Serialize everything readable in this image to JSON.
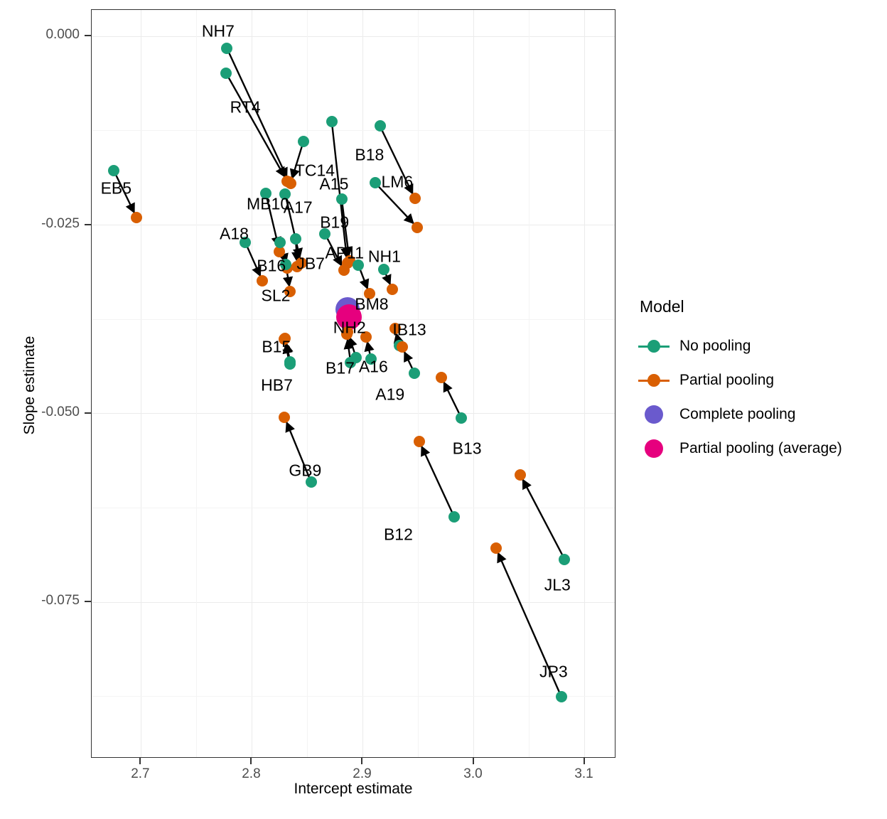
{
  "chart_data": {
    "type": "scatter",
    "title": "",
    "xlabel": "Intercept estimate",
    "ylabel": "Slope estimate",
    "xlim": [
      2.6555,
      3.1285
    ],
    "ylim": [
      -0.0957,
      0.0035
    ],
    "xticks": [
      2.7,
      2.8,
      2.9,
      3.0,
      3.1
    ],
    "xtick_labels": [
      "2.7",
      "2.8",
      "2.9",
      "3.0",
      "3.1"
    ],
    "yticks": [
      0.0,
      -0.025,
      -0.05,
      -0.075
    ],
    "ytick_labels": [
      "0.000",
      "-0.025",
      "-0.050",
      "-0.075"
    ],
    "grid": true,
    "legend_position": "right",
    "legend_title": "Model",
    "series": [
      {
        "name": "No pooling",
        "color": "#1b9e77",
        "marker": "circle"
      },
      {
        "name": "Partial pooling",
        "color": "#d95f02",
        "marker": "circle"
      },
      {
        "name": "Complete pooling",
        "color": "#6a5acd",
        "marker": "circle"
      },
      {
        "name": "Partial pooling (average)",
        "color": "#e6007e",
        "marker": "circle"
      }
    ],
    "complete_pooling": {
      "x": 2.8865,
      "y": -0.0362,
      "label": "Complete pooling"
    },
    "partial_pooling_average": {
      "x": 2.8877,
      "y": -0.0372,
      "label": "Partial pooling (average)"
    },
    "points": [
      {
        "label": "NH7",
        "no_pooling": {
          "x": 2.7775,
          "y": -0.0016
        },
        "partial_pooling": {
          "x": 2.8335,
          "y": -0.0193
        },
        "label_x": 2.7695,
        "label_y": 0.0007
      },
      {
        "label": "RT4",
        "no_pooling": {
          "x": 2.7768,
          "y": -0.0049
        },
        "partial_pooling": {
          "x": 2.8318,
          "y": -0.0192
        },
        "label_x": 2.794,
        "label_y": -0.0094
      },
      {
        "label": "TC14",
        "no_pooling": {
          "x": 2.8465,
          "y": -0.0139
        },
        "partial_pooling": {
          "x": 2.8348,
          "y": -0.0195
        },
        "label_x": 2.8567,
        "label_y": -0.0178
      },
      {
        "label": "EB5",
        "no_pooling": {
          "x": 2.6755,
          "y": -0.0178
        },
        "partial_pooling": {
          "x": 2.696,
          "y": -0.024
        },
        "label_x": 2.6775,
        "label_y": -0.0201
      },
      {
        "label": "B18",
        "no_pooling": {
          "x": 2.9155,
          "y": -0.0119
        },
        "partial_pooling": {
          "x": 2.947,
          "y": -0.0215
        },
        "label_x": 2.906,
        "label_y": -0.0157
      },
      {
        "label": "LM6",
        "no_pooling": {
          "x": 2.911,
          "y": -0.0194
        },
        "partial_pooling": {
          "x": 2.949,
          "y": -0.0253
        },
        "label_x": 2.931,
        "label_y": -0.0193
      },
      {
        "label": "A15",
        "no_pooling": {
          "x": 2.872,
          "y": -0.0113
        },
        "partial_pooling": {
          "x": 2.886,
          "y": -0.03
        },
        "label_x": 2.874,
        "label_y": -0.0196
      },
      {
        "label": "MB10",
        "no_pooling": {
          "x": 2.8125,
          "y": -0.0208
        },
        "partial_pooling": {
          "x": 2.825,
          "y": -0.0285
        },
        "label_x": 2.8145,
        "label_y": -0.0222
      },
      {
        "label": "A17",
        "no_pooling": {
          "x": 2.83,
          "y": -0.0209
        },
        "partial_pooling": {
          "x": 2.8443,
          "y": -0.03
        },
        "label_x": 2.8415,
        "label_y": -0.0227
      },
      {
        "label": "B19",
        "no_pooling": {
          "x": 2.881,
          "y": -0.0216
        },
        "partial_pooling": {
          "x": 2.888,
          "y": -0.0298
        },
        "label_x": 2.8745,
        "label_y": -0.0247
      },
      {
        "label": "A18",
        "no_pooling": {
          "x": 2.794,
          "y": -0.0273
        },
        "partial_pooling": {
          "x": 2.8095,
          "y": -0.0324
        },
        "label_x": 2.784,
        "label_y": -0.0262
      },
      {
        "label": "B16",
        "no_pooling": {
          "x": 2.8255,
          "y": -0.0273
        },
        "partial_pooling": {
          "x": 2.832,
          "y": -0.0307
        },
        "label_x": 2.8175,
        "label_y": -0.0304
      },
      {
        "label": "JB7",
        "no_pooling": {
          "x": 2.8395,
          "y": -0.0268
        },
        "partial_pooling": {
          "x": 2.841,
          "y": -0.0305
        },
        "label_x": 2.853,
        "label_y": -0.0301
      },
      {
        "label": "AP11",
        "no_pooling": {
          "x": 2.866,
          "y": -0.0262
        },
        "partial_pooling": {
          "x": 2.883,
          "y": -0.031
        },
        "label_x": 2.8835,
        "label_y": -0.0287
      },
      {
        "label": "SL2",
        "no_pooling": {
          "x": 2.8305,
          "y": -0.0302
        },
        "partial_pooling": {
          "x": 2.8345,
          "y": -0.0338
        },
        "label_x": 2.8215,
        "label_y": -0.0344
      },
      {
        "label": "NH1",
        "no_pooling": {
          "x": 2.919,
          "y": -0.0309
        },
        "partial_pooling": {
          "x": 2.9265,
          "y": -0.0335
        },
        "label_x": 2.9195,
        "label_y": -0.0292
      },
      {
        "label": "BM8",
        "no_pooling": {
          "x": 2.896,
          "y": -0.0303
        },
        "partial_pooling": {
          "x": 2.906,
          "y": -0.0341
        },
        "label_x": 2.908,
        "label_y": -0.0355
      },
      {
        "label": "NH2",
        "no_pooling": {
          "x": 2.894,
          "y": -0.0426
        },
        "partial_pooling": {
          "x": 2.8865,
          "y": -0.0392
        },
        "label_x": 2.888,
        "label_y": -0.0386
      },
      {
        "label": "IB13",
        "no_pooling": {
          "x": 2.933,
          "y": -0.041
        },
        "partial_pooling": {
          "x": 2.929,
          "y": -0.0387
        },
        "label_x": 2.942,
        "label_y": -0.0389
      },
      {
        "label": "B17",
        "no_pooling": {
          "x": 2.889,
          "y": -0.0432
        },
        "partial_pooling": {
          "x": 2.8855,
          "y": -0.0395
        },
        "label_x": 2.8795,
        "label_y": -0.044
      },
      {
        "label": "A16",
        "no_pooling": {
          "x": 2.9075,
          "y": -0.0428
        },
        "partial_pooling": {
          "x": 2.903,
          "y": -0.0398
        },
        "label_x": 2.9095,
        "label_y": -0.0438
      },
      {
        "label": "B15",
        "no_pooling": {
          "x": 2.8345,
          "y": -0.0431
        },
        "partial_pooling": {
          "x": 2.83,
          "y": -0.04
        },
        "label_x": 2.822,
        "label_y": -0.0412
      },
      {
        "label": "HB7",
        "no_pooling": {
          "x": 2.834,
          "y": -0.0434
        },
        "partial_pooling": {
          "x": 2.8295,
          "y": -0.0401
        },
        "label_x": 2.8225,
        "label_y": -0.0462
      },
      {
        "label": "A19",
        "no_pooling": {
          "x": 2.9465,
          "y": -0.0446
        },
        "partial_pooling": {
          "x": 2.9355,
          "y": -0.0412
        },
        "label_x": 2.9245,
        "label_y": -0.0475
      },
      {
        "label": "B13",
        "no_pooling": {
          "x": 2.989,
          "y": -0.0506
        },
        "partial_pooling": {
          "x": 2.971,
          "y": -0.0452
        },
        "label_x": 2.994,
        "label_y": -0.0546
      },
      {
        "label": "GB9",
        "no_pooling": {
          "x": 2.8535,
          "y": -0.0591
        },
        "partial_pooling": {
          "x": 2.8295,
          "y": -0.0505
        },
        "label_x": 2.848,
        "label_y": -0.0575
      },
      {
        "label": "B12",
        "no_pooling": {
          "x": 2.9825,
          "y": -0.0637
        },
        "partial_pooling": {
          "x": 2.951,
          "y": -0.0537
        },
        "label_x": 2.932,
        "label_y": -0.066
      },
      {
        "label": "JL3",
        "no_pooling": {
          "x": 3.082,
          "y": -0.0693
        },
        "partial_pooling": {
          "x": 3.042,
          "y": -0.0581
        },
        "label_x": 3.0755,
        "label_y": -0.0727
      },
      {
        "label": "JP3",
        "no_pooling": {
          "x": 3.079,
          "y": -0.0875
        },
        "partial_pooling": {
          "x": 3.02,
          "y": -0.0678
        },
        "label_x": 3.072,
        "label_y": -0.0842
      }
    ]
  },
  "axes": {
    "x_title": "Intercept estimate",
    "y_title": "Slope estimate"
  },
  "legend": {
    "title": "Model",
    "items": [
      {
        "label": "No pooling",
        "color": "#1b9e77",
        "kind": "line-dot"
      },
      {
        "label": "Partial pooling",
        "color": "#d95f02",
        "kind": "line-dot"
      },
      {
        "label": "Complete pooling",
        "color": "#6a5acd",
        "kind": "dot"
      },
      {
        "label": "Partial pooling (average)",
        "color": "#e6007e",
        "kind": "dot"
      }
    ]
  }
}
